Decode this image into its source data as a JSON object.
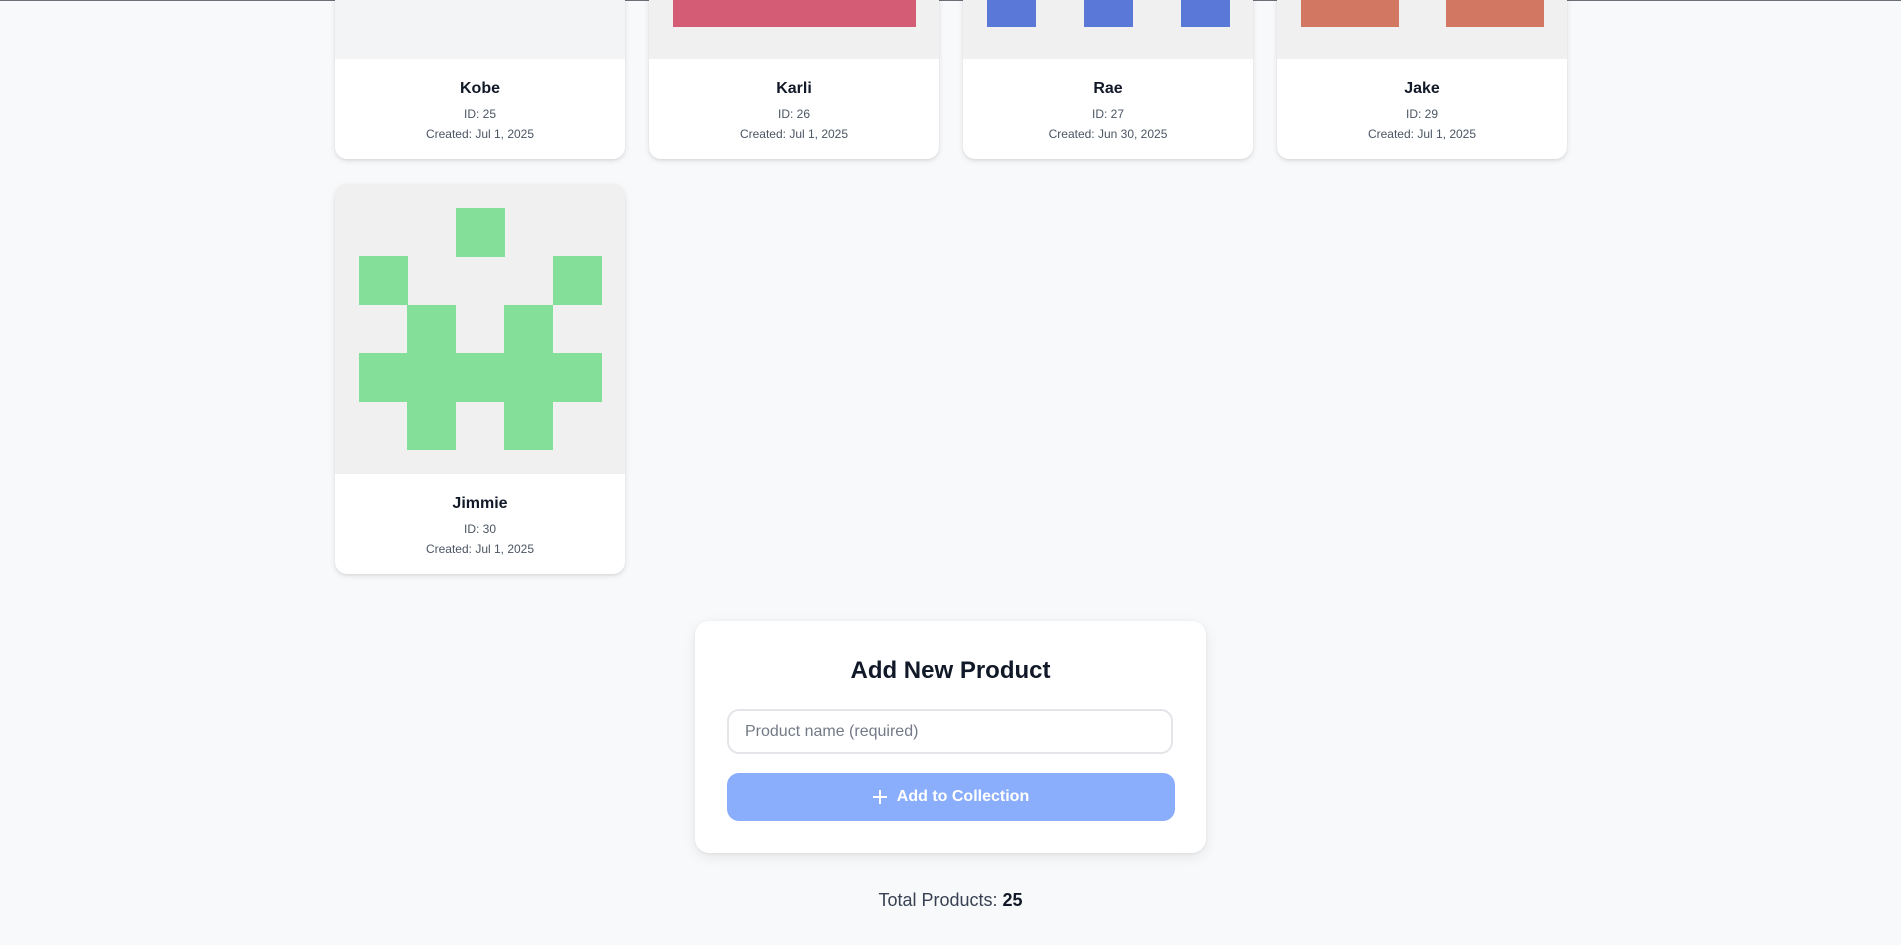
{
  "products": [
    {
      "name": "Kobe",
      "id_text": "ID: 25",
      "created_text": "Created: Jul 1, 2025",
      "color": "#f3f4f6"
    },
    {
      "name": "Karli",
      "id_text": "ID: 26",
      "created_text": "Created: Jul 1, 2025",
      "color": "#d45c75"
    },
    {
      "name": "Rae",
      "id_text": "ID: 27",
      "created_text": "Created: Jun 30, 2025",
      "color": "#5a78d8"
    },
    {
      "name": "Jake",
      "id_text": "ID: 29",
      "created_text": "Created: Jul 1, 2025",
      "color": "#d27862"
    },
    {
      "name": "Jimmie",
      "id_text": "ID: 30",
      "created_text": "Created: Jul 1, 2025",
      "color": "#84e098"
    }
  ],
  "form": {
    "title": "Add New Product",
    "input_placeholder": "Product name (required)",
    "input_value": "",
    "button_label": "Add to Collection",
    "button_icon": "plus-icon"
  },
  "summary": {
    "label": "Total Products:",
    "value": "25"
  }
}
